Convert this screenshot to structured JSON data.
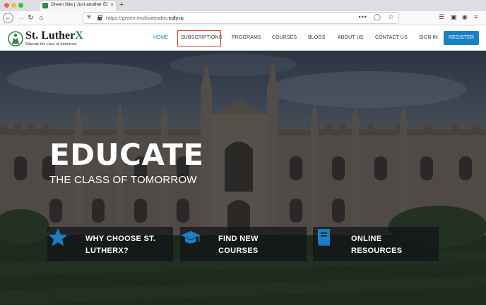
{
  "browser": {
    "tab_title": "Green Site | Just another EDLY",
    "tab_close": "×",
    "new_tab": "+",
    "url_prefix": "https://green.multisitesdev.",
    "url_domain": "edly.io",
    "url_more": "•••"
  },
  "site": {
    "logo_name": "St. Luther",
    "logo_x": "X",
    "tagline": "Educate the class of tomorrow",
    "menu": [
      {
        "label": "HOME",
        "active": true
      },
      {
        "label": "SUBSCRIPTIONS"
      },
      {
        "label": "PROGRAMS"
      },
      {
        "label": "COURSES"
      },
      {
        "label": "BLOGS"
      },
      {
        "label": "ABOUT US"
      },
      {
        "label": "CONTACT US"
      },
      {
        "label": "SIGN IN"
      }
    ],
    "register": "REGISTER"
  },
  "hero": {
    "title": "EDUCATE",
    "subtitle": "THE CLASS OF TOMORROW"
  },
  "features": [
    {
      "line1": "WHY CHOOSE ST.",
      "line2": "LUTHERX?",
      "icon": "star-icon"
    },
    {
      "line1": "FIND NEW",
      "line2": "COURSES",
      "icon": "graduation-cap-icon"
    },
    {
      "line1": "ONLINE",
      "line2": "RESOURCES",
      "icon": "book-icon"
    }
  ],
  "colors": {
    "brand_blue": "#1a7fc4",
    "brand_green": "#2f8a3f",
    "highlight_red": "#d2402c"
  }
}
